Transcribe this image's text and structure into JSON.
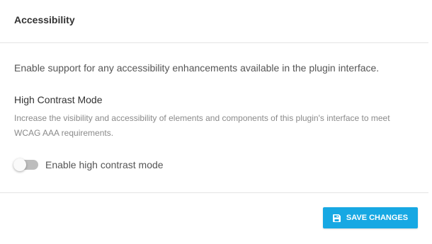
{
  "header": {
    "title": "Accessibility"
  },
  "body": {
    "intro": "Enable support for any accessibility enhancements available in the plugin interface.",
    "high_contrast": {
      "title": "High Contrast Mode",
      "description": "Increase the visibility and accessibility of elements and components of this plugin's interface to meet WCAG AAA requirements.",
      "toggle_label": "Enable high contrast mode",
      "toggle_enabled": false
    }
  },
  "footer": {
    "save_label": "SAVE CHANGES",
    "save_icon": "floppy-disk-icon"
  },
  "colors": {
    "accent": "#17a8e3",
    "toggle_off": "#bdbdbd",
    "divider": "#e4e4e4"
  }
}
